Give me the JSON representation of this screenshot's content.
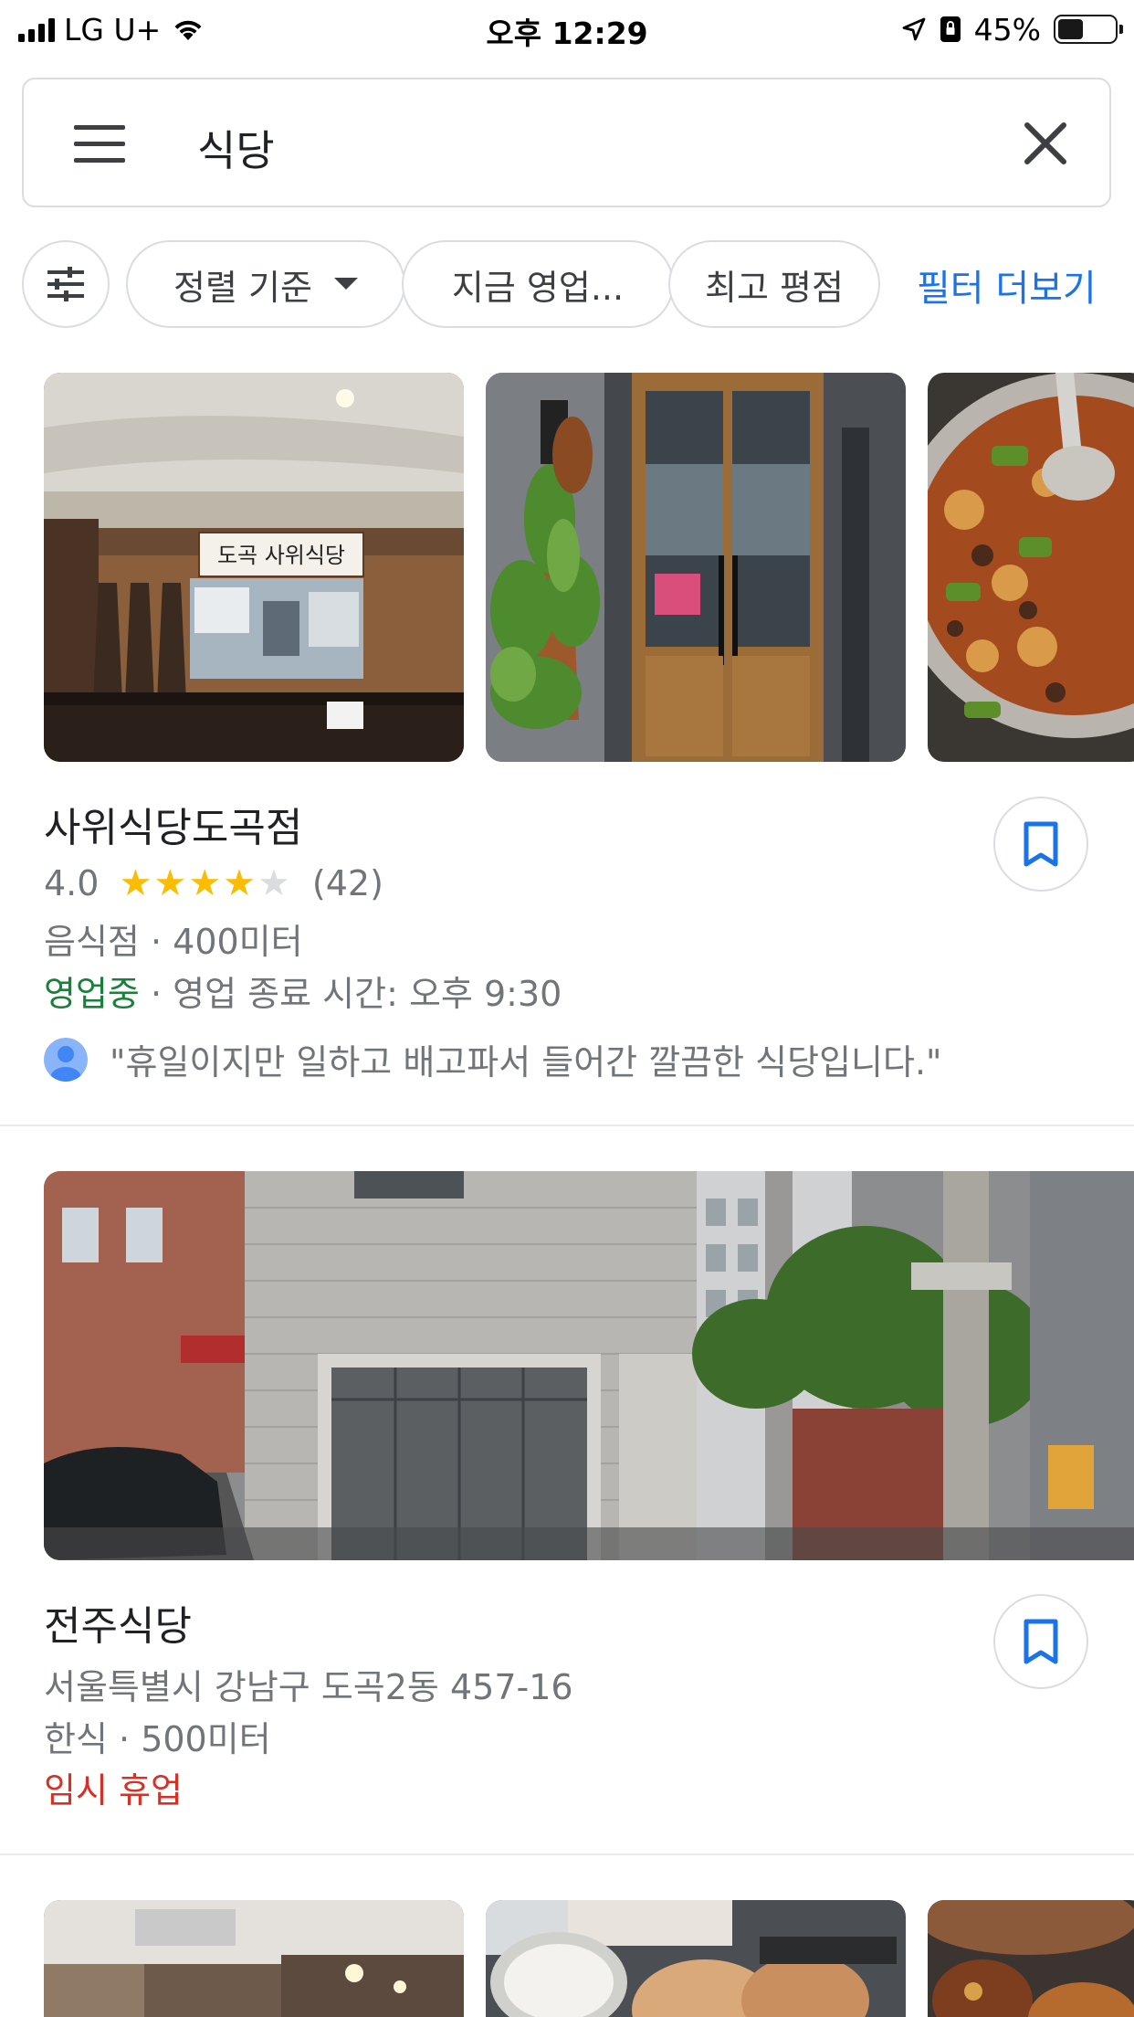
{
  "status_bar": {
    "carrier": "LG U+",
    "time": "오후 12:29",
    "battery": "45%"
  },
  "search": {
    "query": "식당"
  },
  "filters": {
    "sort_label": "정렬 기준",
    "open_now_label": "지금 영업...",
    "top_rated_label": "최고 평점",
    "more_filters_label": "필터 더보기"
  },
  "results": [
    {
      "name": "사위식당도곡점",
      "rating": "4.0",
      "rating_value": 4,
      "review_count": "(42)",
      "category": "음식점",
      "distance": "400미터",
      "status": "영업중",
      "hours_text": "영업 종료 시간: 오후 9:30",
      "review": "\"휴일이지만 일하고 배고파서 들어간 깔끔한 식당입니다.\"",
      "sign_text": "도곡 사위식당"
    },
    {
      "name": "전주식당",
      "address": "서울특별시 강남구 도곡2동 457-16",
      "category": "한식",
      "distance": "500미터",
      "status": "임시 휴업"
    }
  ],
  "separator": "·",
  "colors": {
    "accent_blue": "#1a73e8",
    "open_green": "#188038",
    "closed_red": "#d93025",
    "star_yellow": "#fbbc04"
  }
}
